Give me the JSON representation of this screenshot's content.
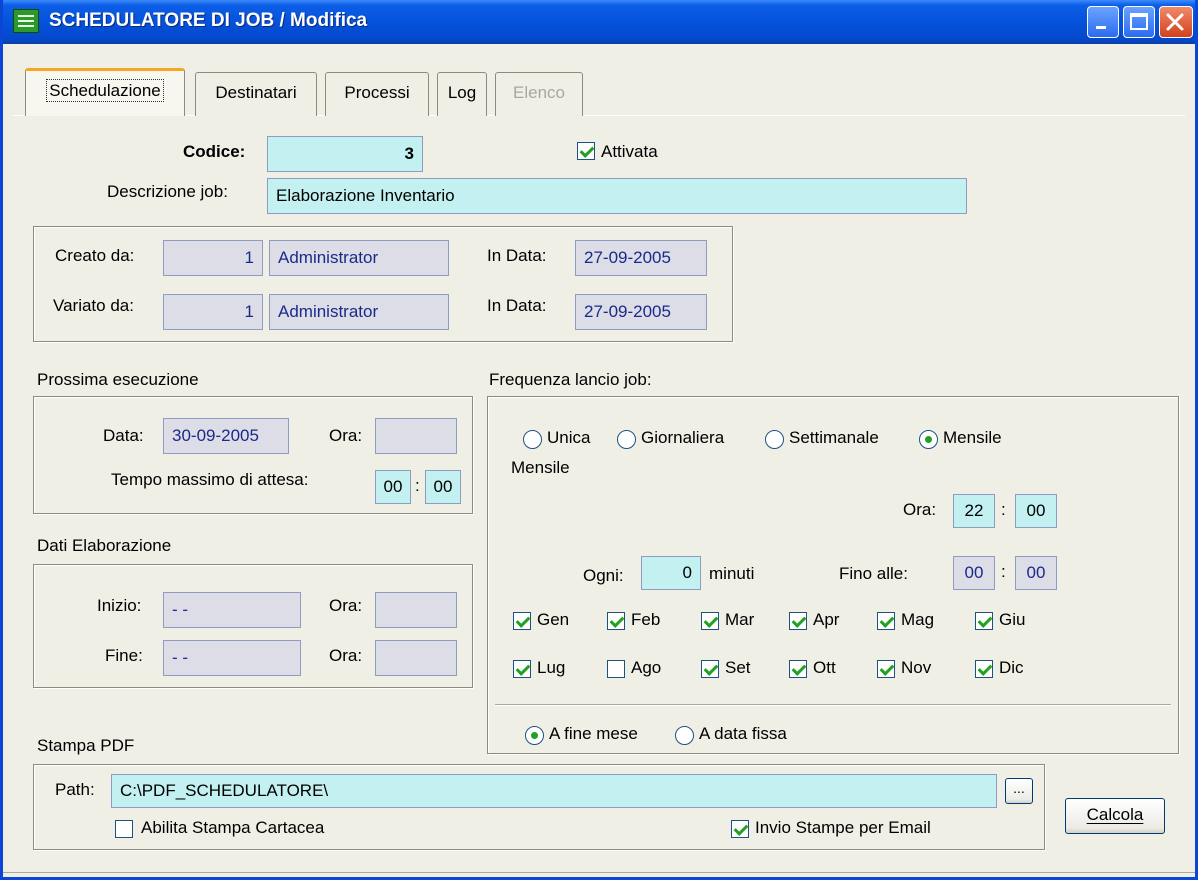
{
  "window": {
    "title": "SCHEDULATORE DI JOB / Modifica"
  },
  "tabs": [
    {
      "label": "Schedulazione",
      "active": true
    },
    {
      "label": "Destinatari"
    },
    {
      "label": "Processi"
    },
    {
      "label": "Log"
    },
    {
      "label": "Elenco",
      "disabled": true
    }
  ],
  "job": {
    "code_label": "Codice:",
    "code": "3",
    "active_label": "Attivata",
    "active": true,
    "desc_label": "Descrizione job:",
    "desc": "Elaborazione Inventario"
  },
  "audit": {
    "created_label": "Creato da:",
    "created_id": "1",
    "created_user": "Administrator",
    "created_date_label": "In Data:",
    "created_date": "27-09-2005",
    "modified_label": "Variato da:",
    "modified_id": "1",
    "modified_user": "Administrator",
    "modified_date_label": "In Data:",
    "modified_date": "27-09-2005"
  },
  "next_run": {
    "title": "Prossima esecuzione",
    "date_label": "Data:",
    "date": "30-09-2005",
    "time_label": "Ora:",
    "time": "",
    "max_wait_label": "Tempo massimo di attesa:",
    "max_wait_h": "00",
    "max_wait_m": "00"
  },
  "processing": {
    "title": "Dati Elaborazione",
    "start_label": "Inizio:",
    "start": "- -",
    "start_time_label": "Ora:",
    "start_time": "",
    "end_label": "Fine:",
    "end": "- -",
    "end_time_label": "Ora:",
    "end_time": ""
  },
  "frequency": {
    "title": "Frequenza lancio job:",
    "options": [
      "Unica",
      "Giornaliera",
      "Settimanale",
      "Mensile"
    ],
    "selected": "Mensile",
    "section_label": "Mensile",
    "time_label": "Ora:",
    "time_h": "22",
    "time_m": "00",
    "every_label": "Ogni:",
    "every": "0",
    "every_unit": "minuti",
    "until_label": "Fino alle:",
    "until_h": "00",
    "until_m": "00",
    "months": [
      {
        "label": "Gen",
        "checked": true
      },
      {
        "label": "Feb",
        "checked": true
      },
      {
        "label": "Mar",
        "checked": true
      },
      {
        "label": "Apr",
        "checked": true
      },
      {
        "label": "Mag",
        "checked": true
      },
      {
        "label": "Giu",
        "checked": true
      },
      {
        "label": "Lug",
        "checked": true
      },
      {
        "label": "Ago",
        "checked": false
      },
      {
        "label": "Set",
        "checked": true
      },
      {
        "label": "Ott",
        "checked": true
      },
      {
        "label": "Nov",
        "checked": true
      },
      {
        "label": "Dic",
        "checked": true
      }
    ],
    "day_options": [
      "A fine mese",
      "A data fissa"
    ],
    "day_selected": "A fine mese"
  },
  "pdf": {
    "title": "Stampa PDF",
    "path_label": "Path:",
    "path": "C:\\PDF_SCHEDULATORE\\",
    "browse_label": "...",
    "paper_label": "Abilita Stampa Cartacea",
    "paper": false,
    "email_label": "Invio Stampe per Email",
    "email": true
  },
  "actions": {
    "calc_label": "Calcola"
  },
  "colors": {
    "titlebar": "#0552db",
    "field_bg": "#c3f0f0",
    "readonly_bg": "#dcdde6",
    "tab_accent": "#f5a623",
    "check": "#21a121"
  },
  "icons": {
    "app": "table-app-icon",
    "minimize": "minimize-icon",
    "maximize": "maximize-icon",
    "close": "close-icon"
  }
}
